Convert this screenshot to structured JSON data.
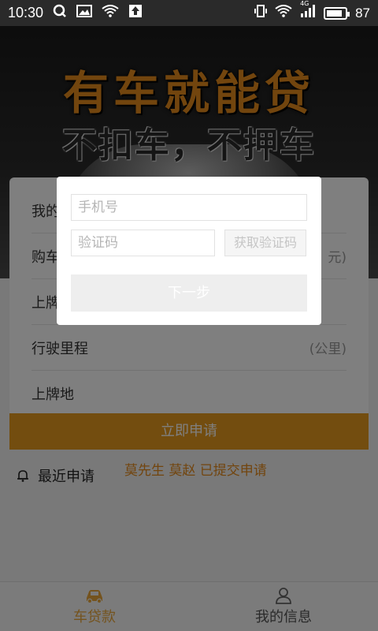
{
  "status_bar": {
    "time": "10:30",
    "network": "4G",
    "battery": "87"
  },
  "banner": {
    "headline": "有车就能贷",
    "subheadline": "不扣车，不押车"
  },
  "form": {
    "rows": [
      {
        "label": "我的",
        "unit": ""
      },
      {
        "label": "购车",
        "unit": "元)"
      },
      {
        "label": "上牌",
        "unit": ""
      },
      {
        "label": "行驶里程",
        "unit": "(公里)"
      },
      {
        "label": "上牌地",
        "unit": ""
      }
    ],
    "apply_label": "立即申请"
  },
  "recent": {
    "title": "最近申请",
    "ticker": "莫先生 莫赵 已提交申请"
  },
  "bottom_nav": [
    {
      "label": "车贷款"
    },
    {
      "label": "我的信息"
    }
  ],
  "dialog": {
    "phone_placeholder": "手机号",
    "code_placeholder": "验证码",
    "get_code_label": "获取验证码",
    "next_label": "下一步"
  },
  "colors": {
    "accent": "#e79a1e",
    "tab_active": "#e8a73d"
  }
}
